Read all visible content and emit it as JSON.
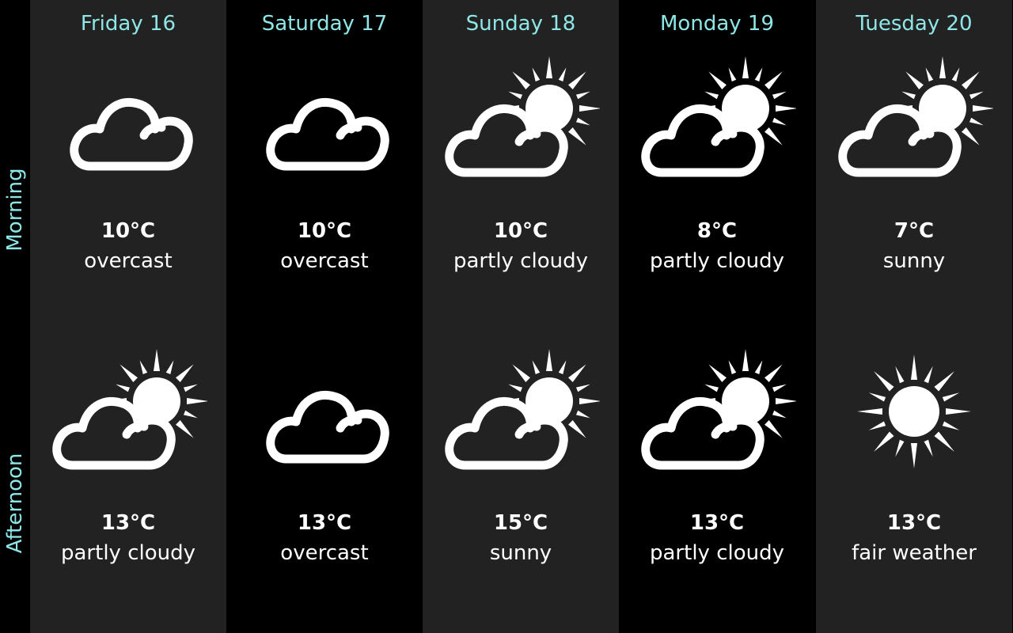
{
  "periods": [
    "Morning",
    "Afternoon"
  ],
  "days": [
    {
      "name": "Friday 16",
      "morning": {
        "temp": "10°C",
        "condition": "overcast",
        "icon": "cloud-icon"
      },
      "afternoon": {
        "temp": "13°C",
        "condition": "partly cloudy",
        "icon": "partly-cloudy-icon"
      }
    },
    {
      "name": "Saturday 17",
      "morning": {
        "temp": "10°C",
        "condition": "overcast",
        "icon": "cloud-icon"
      },
      "afternoon": {
        "temp": "13°C",
        "condition": "overcast",
        "icon": "cloud-icon"
      }
    },
    {
      "name": "Sunday 18",
      "morning": {
        "temp": "10°C",
        "condition": "partly cloudy",
        "icon": "partly-cloudy-icon"
      },
      "afternoon": {
        "temp": "15°C",
        "condition": "sunny",
        "icon": "partly-cloudy-icon"
      }
    },
    {
      "name": "Monday 19",
      "morning": {
        "temp": "8°C",
        "condition": "partly cloudy",
        "icon": "partly-cloudy-icon"
      },
      "afternoon": {
        "temp": "13°C",
        "condition": "partly cloudy",
        "icon": "partly-cloudy-icon"
      }
    },
    {
      "name": "Tuesday 20",
      "morning": {
        "temp": "7°C",
        "condition": "sunny",
        "icon": "partly-cloudy-icon"
      },
      "afternoon": {
        "temp": "13°C",
        "condition": "fair weather",
        "icon": "sun-icon"
      }
    }
  ],
  "colors": {
    "accent": "#8ee6e6",
    "column_dark": "#222222",
    "column_black": "#000000",
    "text": "#ffffff"
  }
}
